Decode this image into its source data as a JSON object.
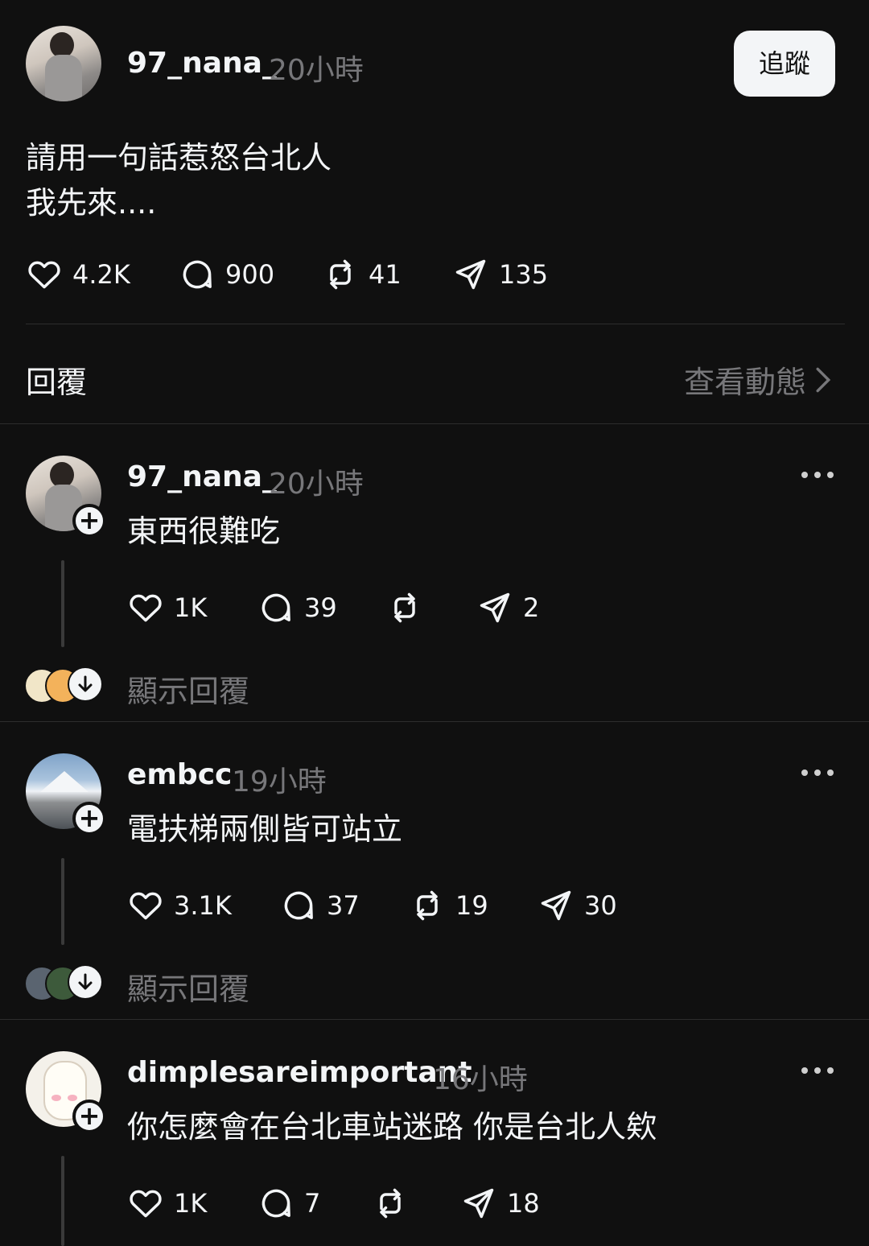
{
  "post": {
    "username": "97_nana_",
    "time": "20小時",
    "follow_label": "追蹤",
    "lines": [
      "請用一句話惹怒台北人",
      "我先來...."
    ],
    "likes": "4.2K",
    "comments": "900",
    "reposts": "41",
    "shares": "135"
  },
  "replies_header": {
    "title": "回覆",
    "activity_label": "查看動態"
  },
  "replies": [
    {
      "username": "97_nana_",
      "time": "20小時",
      "text": "東西很難吃",
      "likes": "1K",
      "comments": "39",
      "reposts": "",
      "shares": "2",
      "show_replies": "顯示回覆"
    },
    {
      "username": "embcc",
      "time": "19小時",
      "text": "電扶梯兩側皆可站立",
      "likes": "3.1K",
      "comments": "37",
      "reposts": "19",
      "shares": "30",
      "show_replies": "顯示回覆"
    },
    {
      "username": "dimplesareimportant",
      "time": "16小時",
      "text": "你怎麼會在台北車站迷路 你是台北人欸",
      "likes": "1K",
      "comments": "7",
      "reposts": "",
      "shares": "18"
    }
  ],
  "icons": {
    "like": "heart-icon",
    "comment": "comment-bubble-icon",
    "repost": "repost-icon",
    "share": "share-send-icon",
    "more": "more-options-icon",
    "follow_add": "plus-icon",
    "expand": "arrow-down-icon",
    "chevron": "chevron-right-icon"
  },
  "colors": {
    "background": "#101010",
    "text": "#f3f5f7",
    "muted": "#77777a",
    "divider": "#2d2d2d"
  }
}
